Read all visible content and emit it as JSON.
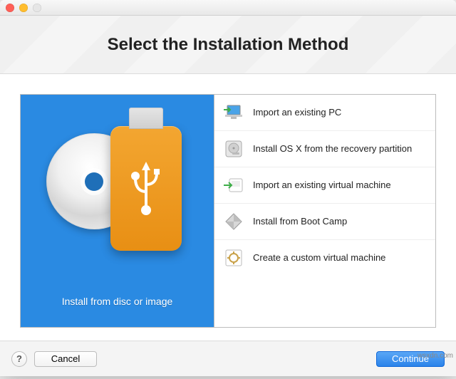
{
  "header": {
    "title": "Select the Installation Method"
  },
  "left": {
    "caption": "Install from disc or image"
  },
  "options": [
    {
      "icon": "pc-import-icon",
      "label": "Import an existing PC"
    },
    {
      "icon": "hard-drive-icon",
      "label": "Install OS X from the recovery partition"
    },
    {
      "icon": "vm-import-icon",
      "label": "Import an existing virtual machine"
    },
    {
      "icon": "bootcamp-icon",
      "label": "Install from Boot Camp"
    },
    {
      "icon": "custom-vm-icon",
      "label": "Create a custom virtual machine"
    }
  ],
  "footer": {
    "help": "?",
    "cancel": "Cancel",
    "continue": "Continue"
  },
  "watermark": "wsxdn.com",
  "colors": {
    "panel_blue": "#2a8ae2",
    "primary_button": "#2b83ea",
    "usb_orange": "#e88f14"
  }
}
